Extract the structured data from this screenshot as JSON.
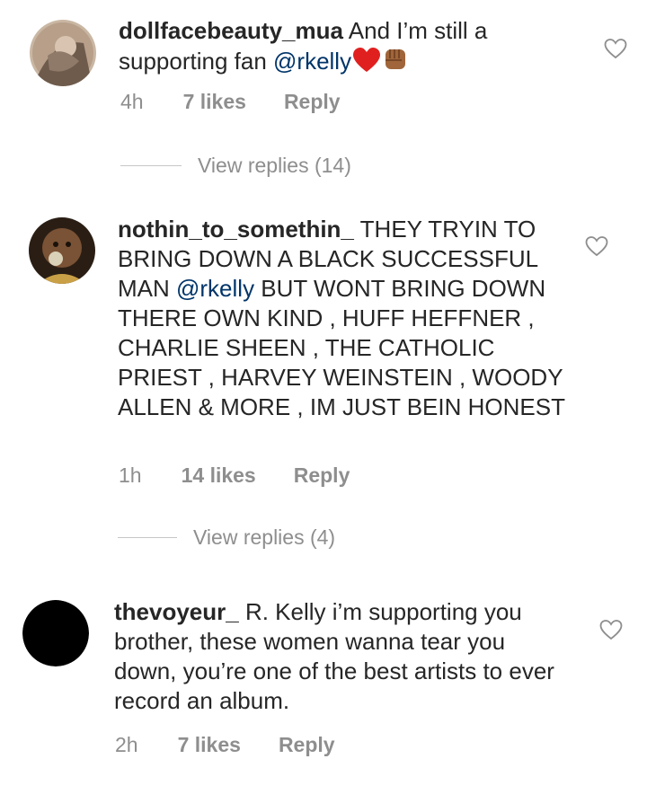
{
  "comments": [
    {
      "username": "dollfacebeauty_mua",
      "text_before": " And I’m still a supporting fan ",
      "mention": "@rkelly",
      "text_after": "",
      "emoji": [
        "red-heart",
        "raised-fist"
      ],
      "time": "4h",
      "likes": "7 likes",
      "reply": "Reply",
      "view_replies": "View replies (14)"
    },
    {
      "username": "nothin_to_somethin_",
      "text_before": " THEY TRYIN TO BRING DOWN A BLACK SUCCESSFUL MAN ",
      "mention": "@rkelly",
      "text_after": " BUT WONT BRING DOWN THERE OWN KIND , HUFF HEFFNER , CHARLIE SHEEN , THE CATHOLIC PRIEST , HARVEY WEINSTEIN , WOODY ALLEN & MORE , IM JUST BEIN HONEST",
      "time": "1h",
      "likes": "14 likes",
      "reply": "Reply",
      "view_replies": "View replies (4)"
    },
    {
      "username": "thevoyeur_",
      "text_before": " R. Kelly i’m supporting you brother, these women wanna tear you down, you’re one of the best artists to ever record an album.",
      "time": "2h",
      "likes": "7 likes",
      "reply": "Reply"
    }
  ],
  "colors": {
    "text": "#262626",
    "meta": "#8e8e8e",
    "mention": "#003569",
    "heart_outline": "#8e8e8e"
  },
  "icons": {
    "like": "heart-outline-icon"
  }
}
